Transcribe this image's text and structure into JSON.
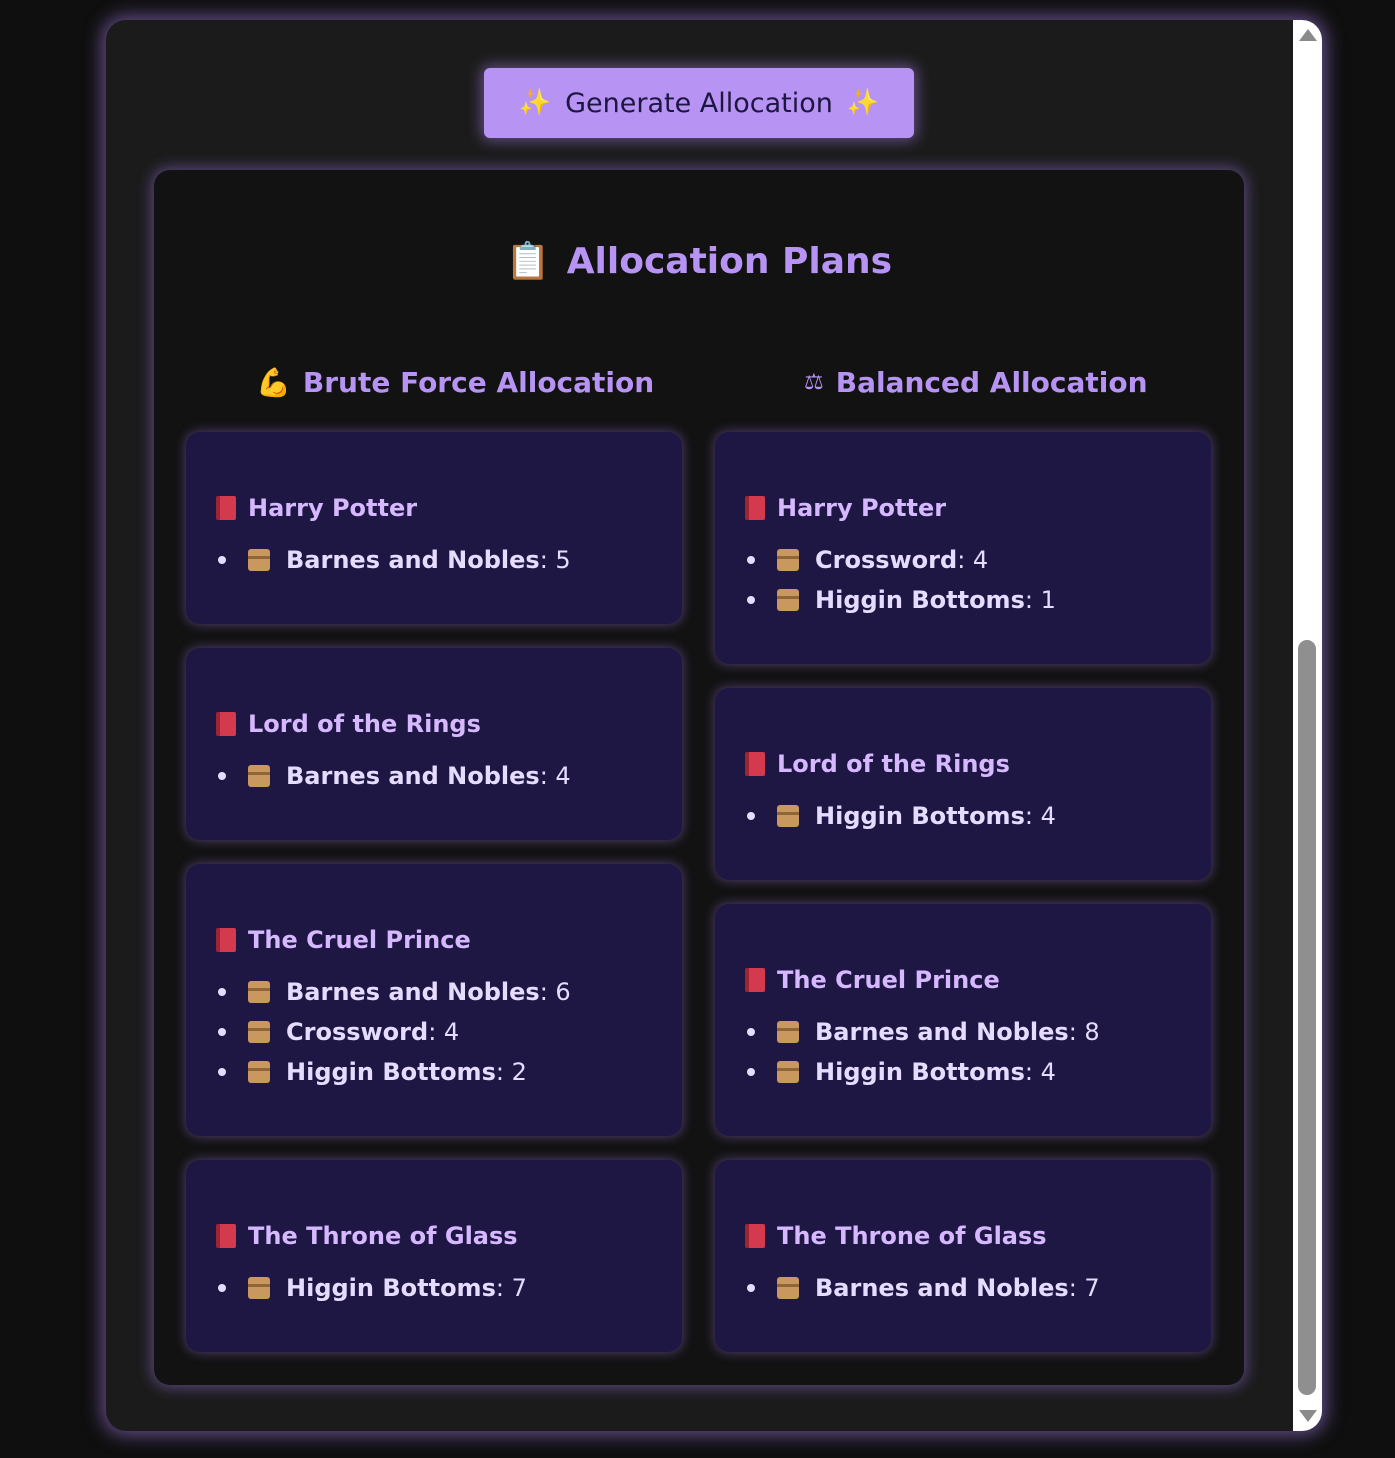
{
  "generate_button": {
    "label": "Generate Allocation",
    "icon": "sparkles-icon"
  },
  "panel": {
    "title": "Allocation Plans",
    "icon": "clipboard-icon"
  },
  "columns": [
    {
      "title": "Brute Force Allocation",
      "icon": "flexed-biceps-icon",
      "books": [
        {
          "title": "Harry Potter",
          "allocations": [
            {
              "store": "Barnes and Nobles",
              "qty": ": 5"
            }
          ]
        },
        {
          "title": "Lord of the Rings",
          "allocations": [
            {
              "store": "Barnes and Nobles",
              "qty": ": 4"
            }
          ]
        },
        {
          "title": "The Cruel Prince",
          "allocations": [
            {
              "store": "Barnes and Nobles",
              "qty": ": 6"
            },
            {
              "store": "Crossword",
              "qty": ": 4"
            },
            {
              "store": "Higgin Bottoms",
              "qty": ": 2"
            }
          ]
        },
        {
          "title": "The Throne of Glass",
          "allocations": [
            {
              "store": "Higgin Bottoms",
              "qty": ": 7"
            }
          ]
        }
      ]
    },
    {
      "title": "Balanced Allocation",
      "icon": "balance-scale-icon",
      "books": [
        {
          "title": "Harry Potter",
          "allocations": [
            {
              "store": "Crossword",
              "qty": ": 4"
            },
            {
              "store": "Higgin Bottoms",
              "qty": ": 1"
            }
          ]
        },
        {
          "title": "Lord of the Rings",
          "allocations": [
            {
              "store": "Higgin Bottoms",
              "qty": ": 4"
            }
          ]
        },
        {
          "title": "The Cruel Prince",
          "allocations": [
            {
              "store": "Barnes and Nobles",
              "qty": ": 8"
            },
            {
              "store": "Higgin Bottoms",
              "qty": ": 4"
            }
          ]
        },
        {
          "title": "The Throne of Glass",
          "allocations": [
            {
              "store": "Barnes and Nobles",
              "qty": ": 7"
            }
          ]
        }
      ]
    }
  ],
  "colors": {
    "accent": "#b794f4",
    "card_bg": "#1e1744",
    "panel_bg": "#121212",
    "page_bg": "#1b1b1b"
  }
}
